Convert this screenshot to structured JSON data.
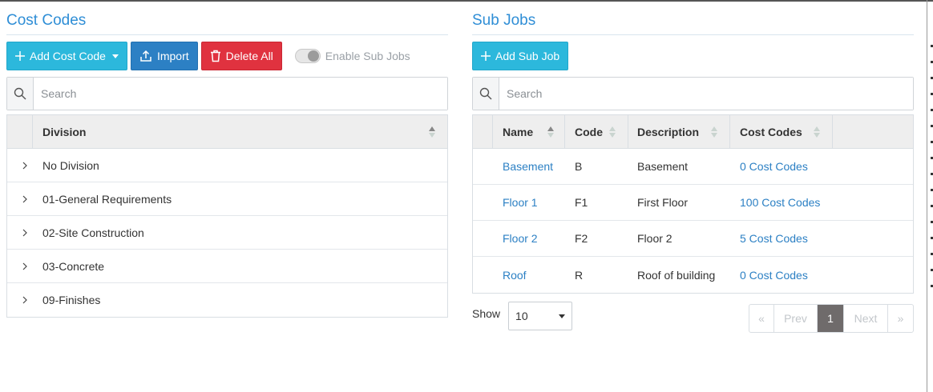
{
  "colors": {
    "accent": "#2f8ed6",
    "info": "#2cb8dc",
    "primary": "#2c80c4",
    "danger": "#e0323f",
    "active_page": "#6f6b6b"
  },
  "cost_codes": {
    "title": "Cost Codes",
    "add_label": "Add Cost Code",
    "import_label": "Import",
    "delete_label": "Delete All",
    "toggle_label": "Enable Sub Jobs",
    "toggle_on": false,
    "search_placeholder": "Search",
    "column_header": "Division",
    "divisions": [
      {
        "label": "No Division"
      },
      {
        "label": "01-General Requirements"
      },
      {
        "label": "02-Site Construction"
      },
      {
        "label": "03-Concrete"
      },
      {
        "label": "09-Finishes"
      }
    ]
  },
  "sub_jobs": {
    "title": "Sub Jobs",
    "add_label": "Add Sub Job",
    "search_placeholder": "Search",
    "columns": {
      "name": "Name",
      "code": "Code",
      "description": "Description",
      "cost_codes": "Cost Codes"
    },
    "rows": [
      {
        "name": "Basement",
        "code": "B",
        "description": "Basement",
        "cost_codes": "0 Cost Codes"
      },
      {
        "name": "Floor 1",
        "code": "F1",
        "description": "First Floor",
        "cost_codes": "100 Cost Codes"
      },
      {
        "name": "Floor 2",
        "code": "F2",
        "description": "Floor 2",
        "cost_codes": "5 Cost Codes"
      },
      {
        "name": "Roof",
        "code": "R",
        "description": "Roof of building",
        "cost_codes": "0 Cost Codes"
      }
    ],
    "show_label": "Show",
    "page_size": "10",
    "pagination": {
      "first": "«",
      "prev": "Prev",
      "current": "1",
      "next": "Next",
      "last": "»"
    }
  }
}
